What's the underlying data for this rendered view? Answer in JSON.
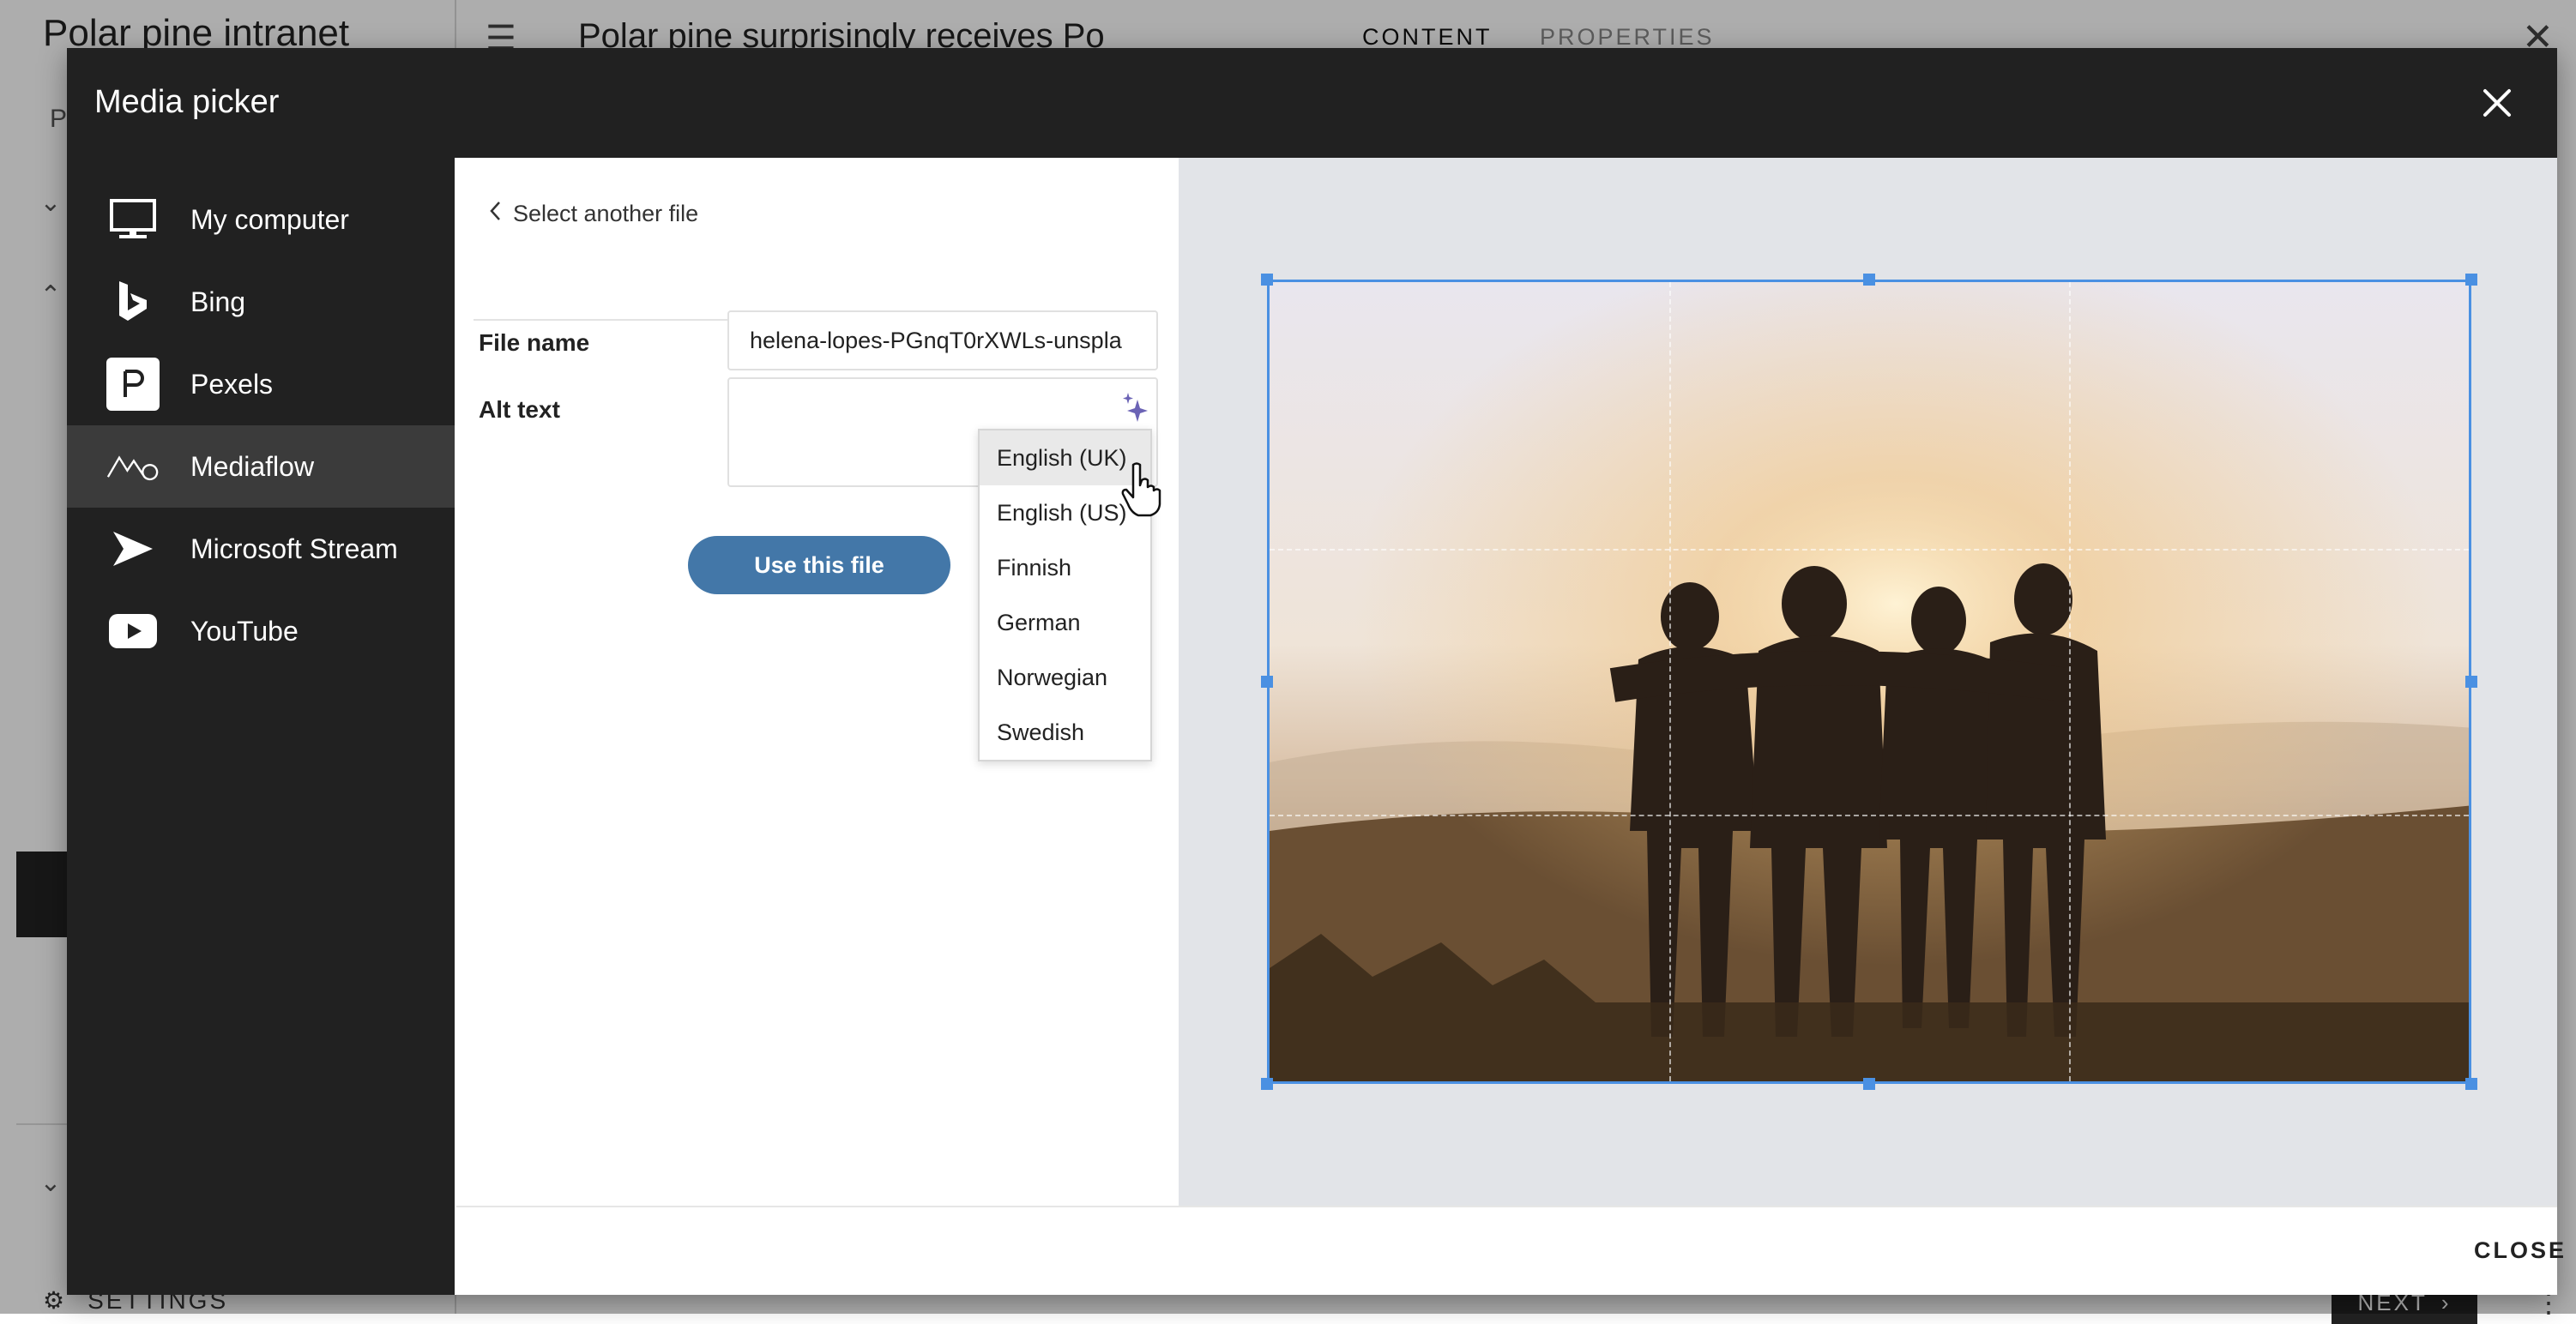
{
  "background_app": {
    "app_title": "Polar pine intranet",
    "left_letter": "P",
    "page_title": "Polar pine surprisingly receives Po",
    "tab_content": "CONTENT",
    "tab_properties": "PROPERTIES",
    "settings_label": "SETTINGS",
    "next_label": "NEXT"
  },
  "dialog": {
    "title": "Media picker",
    "close_label": "CLOSE"
  },
  "sources": [
    {
      "label": "My computer",
      "icon": "monitor-icon"
    },
    {
      "label": "Bing",
      "icon": "bing-icon"
    },
    {
      "label": "Pexels",
      "icon": "pexels-icon"
    },
    {
      "label": "Mediaflow",
      "icon": "mediaflow-icon",
      "active": true
    },
    {
      "label": "Microsoft Stream",
      "icon": "stream-icon"
    },
    {
      "label": "YouTube",
      "icon": "youtube-icon"
    }
  ],
  "form": {
    "back_label": "Select another file",
    "file_name_label": "File name",
    "file_name_value": "helena-lopes-PGnqT0rXWLs-unspla",
    "alt_text_label": "Alt text",
    "use_button": "Use this file"
  },
  "language_menu": {
    "options": [
      "English (UK)",
      "English (US)",
      "Finnish",
      "German",
      "Norwegian",
      "Swedish"
    ],
    "hovered": "English (UK)"
  },
  "colors": {
    "header_bg": "#212121",
    "accent_button": "#4377a8",
    "crop_border": "#4a90e2",
    "preview_bg": "#e2e4e8"
  }
}
